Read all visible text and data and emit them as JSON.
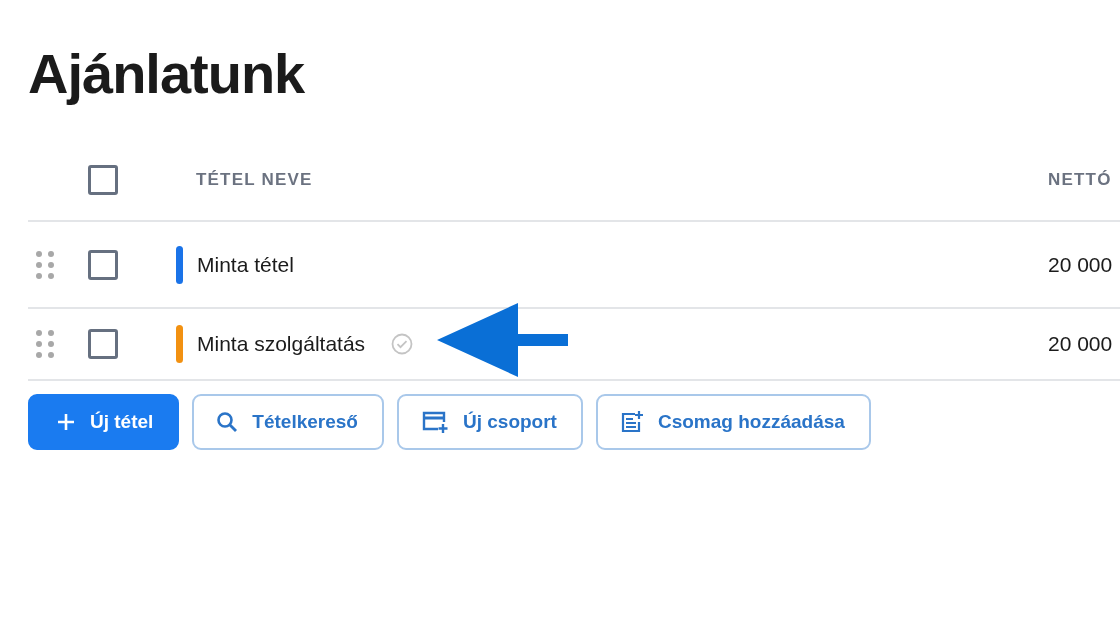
{
  "title": "Ajánlatunk",
  "table": {
    "select_all": {
      "checked": false
    },
    "columns": [
      "TÉTEL NEVE",
      "NETTÓ"
    ],
    "rows": [
      {
        "name": "Minta tétel",
        "color": "#1a73e8",
        "checked": false,
        "confirmed": false,
        "column_2": "20 000"
      },
      {
        "name": "Minta szolgáltatás",
        "color": "#f29111",
        "checked": false,
        "confirmed": true,
        "column_2": "20 000"
      }
    ]
  },
  "buttons": [
    {
      "label": "Új tétel",
      "kind": "add"
    },
    {
      "label": "Tételkereső",
      "kind": "search"
    },
    {
      "label": "Új csoport",
      "kind": "group"
    },
    {
      "label": "Csomag hozzáadása",
      "kind": "package"
    }
  ]
}
